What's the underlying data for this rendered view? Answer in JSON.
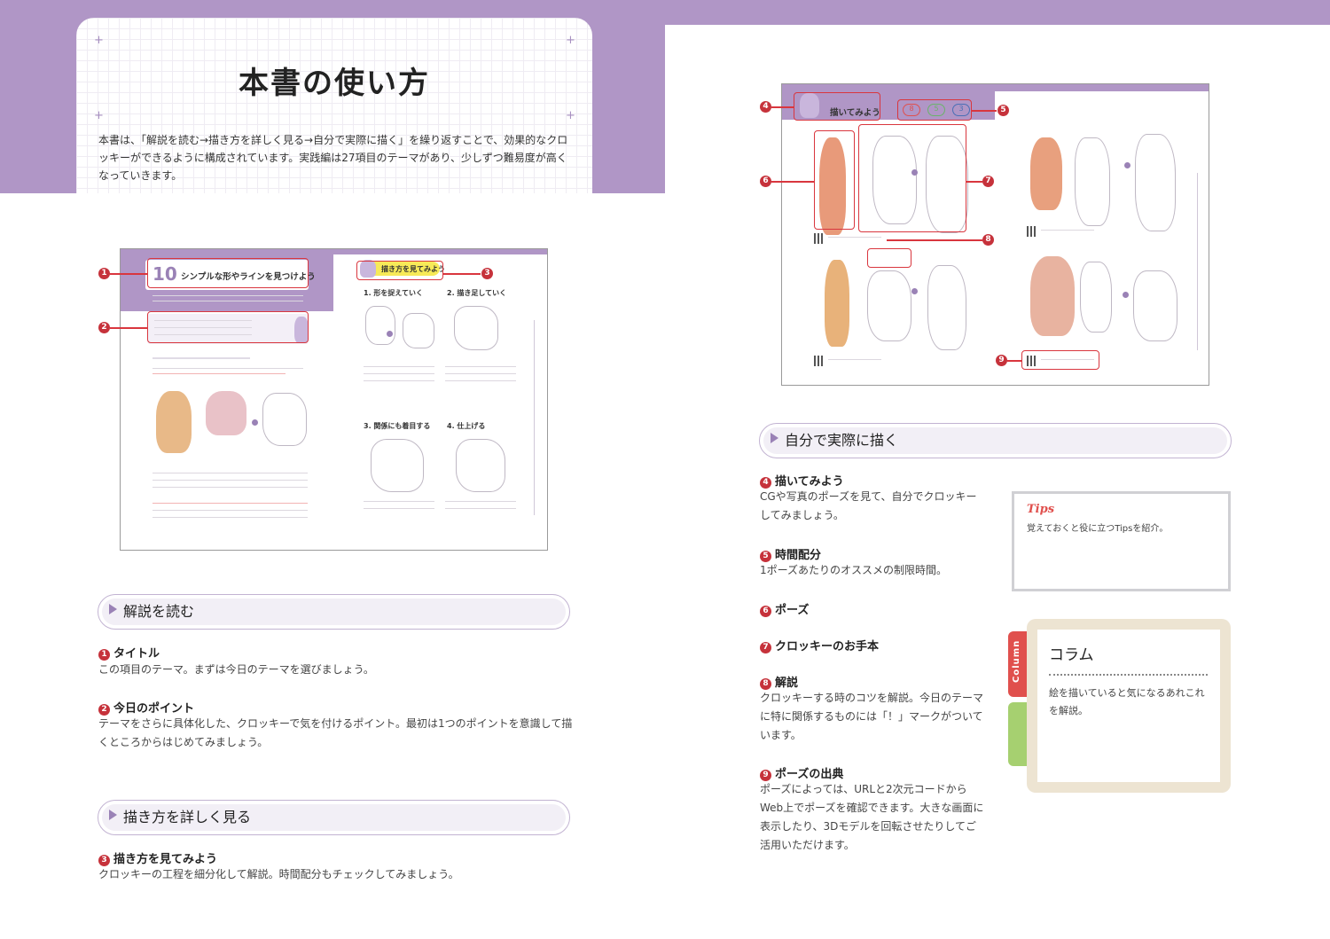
{
  "header": {
    "title": "本書の使い方",
    "intro": "本書は、「解説を読む→描き方を詳しく見る→自分で実際に描く」を繰り返すことで、効果的なクロッキーができるように構成されています。実践編は27項目のテーマがあり、少しずつ難易度が高くなっていきます。"
  },
  "thumb_left": {
    "number": "10",
    "title": "シンプルな形やラインを見つけよう",
    "step_header": "描き方を見てみよう",
    "steps": [
      "1. 形を捉えていく",
      "2. 描き足していく",
      "3. 関係にも着目する",
      "4. 仕上げる"
    ],
    "markers": [
      "1",
      "2",
      "3"
    ]
  },
  "thumb_right": {
    "label": "描いてみよう",
    "times": [
      "8",
      "5",
      "3"
    ],
    "markers": [
      "4",
      "5",
      "6",
      "7",
      "8",
      "9"
    ]
  },
  "sections": [
    {
      "title": "解説を読む",
      "items": [
        {
          "num": "1",
          "head": "タイトル",
          "body": "この項目のテーマ。まずは今日のテーマを選びましょう。"
        },
        {
          "num": "2",
          "head": "今日のポイント",
          "body": "テーマをさらに具体化した、クロッキーで気を付けるポイント。最初は1つのポイントを意識して描くところからはじめてみましょう。"
        }
      ]
    },
    {
      "title": "描き方を詳しく見る",
      "items": [
        {
          "num": "3",
          "head": "描き方を見てみよう",
          "body": "クロッキーの工程を細分化して解説。時間配分もチェックしてみましょう。"
        }
      ]
    },
    {
      "title": "自分で実際に描く",
      "items": [
        {
          "num": "4",
          "head": "描いてみよう",
          "body": "CGや写真のポーズを見て、自分でクロッキーしてみましょう。"
        },
        {
          "num": "5",
          "head": "時間配分",
          "body": "1ポーズあたりのオススメの制限時間。"
        },
        {
          "num": "6",
          "head": "ポーズ",
          "body": ""
        },
        {
          "num": "7",
          "head": "クロッキーのお手本",
          "body": ""
        },
        {
          "num": "8",
          "head": "解説",
          "body": "クロッキーする時のコツを解説。今日のテーマに特に関係するものには「！」マークがついています。"
        },
        {
          "num": "9",
          "head": "ポーズの出典",
          "body": "ポーズによっては、URLと2次元コードからWeb上でポーズを確認できます。大きな画面に表示したり、3Dモデルを回転させたりしてご活用いただけます。"
        }
      ]
    }
  ],
  "tips": {
    "logo": "Tips",
    "text": "覚えておくと役に立つTipsを紹介。"
  },
  "column": {
    "tab": "Column",
    "title": "コラム",
    "text": "絵を描いていると気になるあれこれを解説。"
  },
  "colors": {
    "purple": "#b096c6",
    "marker_red": "#c6323b",
    "column_beige": "#ede4d2",
    "tab_red": "#e0504d",
    "tab_green": "#a6d070"
  }
}
